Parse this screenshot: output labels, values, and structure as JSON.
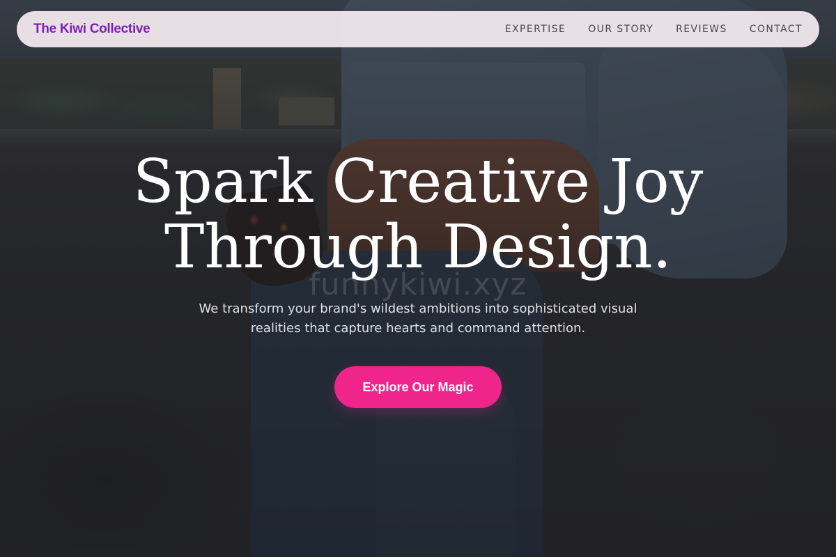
{
  "navbar": {
    "brand": "The Kiwi Collective",
    "links": [
      {
        "label": "EXPERTISE"
      },
      {
        "label": "OUR STORY"
      },
      {
        "label": "REVIEWS"
      },
      {
        "label": "CONTACT"
      }
    ]
  },
  "hero": {
    "title_line1": "Spark Creative Joy",
    "title_line2": "Through Design.",
    "subtitle": "We transform your brand's wildest ambitions into sophisticated visual realities that capture hearts and command attention.",
    "cta_label": "Explore Our Magic",
    "watermark": "funnykiwi.xyz"
  },
  "colors": {
    "brand": "#7a1fb8",
    "cta": "#f0258b",
    "navbar_bg": "#f6ecf2",
    "nav_text": "#4a4550"
  }
}
